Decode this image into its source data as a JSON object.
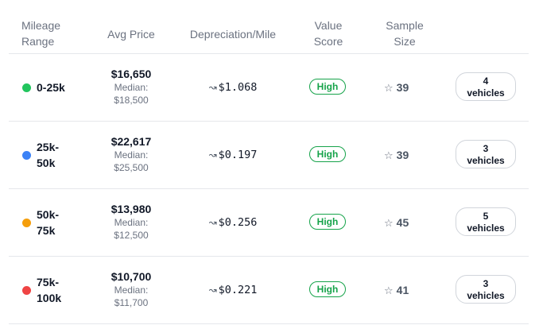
{
  "headers": {
    "range_line1": "Mileage",
    "range_line2": "Range",
    "avg_price": "Avg Price",
    "depreciation": "Depreciation/Mile",
    "value_line1": "Value",
    "value_line2": "Score",
    "sample_line1": "Sample",
    "sample_line2": "Size"
  },
  "rows": [
    {
      "range_line1": "0-25k",
      "range_line2": "",
      "dot_color": "#22c55e",
      "avg_price": "$16,650",
      "median_label": "Median:",
      "median": "$18,500",
      "trend_icon": "↝",
      "depreciation": "$1.068",
      "value_score": "High",
      "star_icon": "☆",
      "sample_size": "39",
      "vehicles_count": "4",
      "vehicles_label": "vehicles"
    },
    {
      "range_line1": "25k-",
      "range_line2": "50k",
      "dot_color": "#3b82f6",
      "avg_price": "$22,617",
      "median_label": "Median:",
      "median": "$25,500",
      "trend_icon": "↝",
      "depreciation": "$0.197",
      "value_score": "High",
      "star_icon": "☆",
      "sample_size": "39",
      "vehicles_count": "3",
      "vehicles_label": "vehicles"
    },
    {
      "range_line1": "50k-",
      "range_line2": "75k",
      "dot_color": "#f59e0b",
      "avg_price": "$13,980",
      "median_label": "Median:",
      "median": "$12,500",
      "trend_icon": "↝",
      "depreciation": "$0.256",
      "value_score": "High",
      "star_icon": "☆",
      "sample_size": "45",
      "vehicles_count": "5",
      "vehicles_label": "vehicles"
    },
    {
      "range_line1": "75k-",
      "range_line2": "100k",
      "dot_color": "#ef4444",
      "avg_price": "$10,700",
      "median_label": "Median:",
      "median": "$11,700",
      "trend_icon": "↝",
      "depreciation": "$0.221",
      "value_score": "High",
      "star_icon": "☆",
      "sample_size": "41",
      "vehicles_count": "3",
      "vehicles_label": "vehicles"
    }
  ]
}
